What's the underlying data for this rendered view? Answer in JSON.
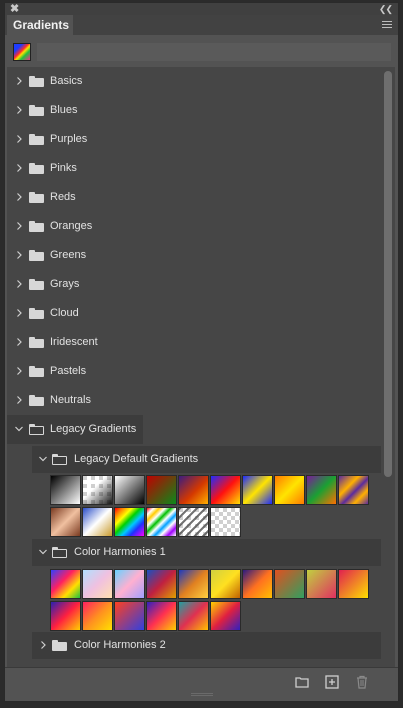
{
  "panel": {
    "tab_label": "Gradients",
    "close_glyph": "✖",
    "collapse_glyph": "❮❮"
  },
  "folders": [
    {
      "label": "Basics"
    },
    {
      "label": "Blues"
    },
    {
      "label": "Purples"
    },
    {
      "label": "Pinks"
    },
    {
      "label": "Reds"
    },
    {
      "label": "Oranges"
    },
    {
      "label": "Greens"
    },
    {
      "label": "Grays"
    },
    {
      "label": "Cloud"
    },
    {
      "label": "Iridescent"
    },
    {
      "label": "Pastels"
    },
    {
      "label": "Neutrals"
    },
    {
      "label": "Legacy Gradients"
    }
  ],
  "subfolders": [
    {
      "label": "Legacy Default Gradients"
    },
    {
      "label": "Color Harmonies 1"
    },
    {
      "label": "Color Harmonies 2"
    }
  ],
  "icons": {
    "expanded": "chevron-down-icon",
    "collapsed": "chevron-right-icon",
    "folder": "folder-icon",
    "new_group": "new-group-icon",
    "new_gradient": "new-gradient-icon",
    "delete": "trash-icon"
  },
  "colors": {
    "panel_bg": "#535353",
    "list_bg": "#464646",
    "selected_row": "#3c3c3c",
    "text": "#e2e2e2"
  },
  "swatches": {
    "legacy_default": [
      "linear-gradient(135deg,#000 0%,#fff 100%)",
      "checker-fade-black",
      "linear-gradient(135deg,#fff 0%,#000 100%)",
      "linear-gradient(135deg,#c00000 0%,#0a8a1a 100%)",
      "linear-gradient(135deg,#3a1c80 0%,#d43800 55%,#ffb000 100%)",
      "linear-gradient(135deg,#1f2cff 0%,#ff1010 50%,#ffe000 100%)",
      "linear-gradient(135deg,#1a2aff 0%,#ffe400 50%,#1a2aff 100%)",
      "linear-gradient(135deg,#ff7a00 0%,#ffe400 50%,#ff7a00 100%)",
      "linear-gradient(135deg,#7a1a9a 0%,#1aa032 50%,#ff7000 100%)",
      "linear-gradient(135deg,#5a2aa0 0%,#ffb000 35%,#5a2aa0 55%,#ffb000 75%,#5a2aa0 100%)",
      "linear-gradient(135deg,#7a3a20 0%,#f0c0a0 50%,#7a3a20 100%)",
      "linear-gradient(135deg,#2b4fc8 0%,#ffffff 50%,#c89a2b 100%)",
      "linear-gradient(135deg,#ff0000 0%,#ff8a00 15%,#ffff00 30%,#00d000 45%,#00c8ff 60%,#2030ff 75%,#ff00ff 100%)",
      "linear-gradient(135deg,#ff0000 0%,#fff 12%,#ffcc00 22%,#fff 32%,#00c000 42%,#fff 52%,#00a0ff 62%,#fff 72%,#a000ff 85%,#fff 100%)",
      "checker-stripes",
      "checker"
    ],
    "harmonies_1": [
      "linear-gradient(135deg,#3040ff 0%,#ff2060 40%,#ffe000 70%,#20c040 100%)",
      "linear-gradient(135deg,#b0e0ff 0%,#f0c0e0 50%,#ffe0b0 100%)",
      "linear-gradient(135deg,#6ad0ff 0%,#ffb0d0 50%,#a0a0ff 100%)",
      "linear-gradient(135deg,#1a50c0 0%,#c02040 50%,#e0a000 100%)",
      "linear-gradient(135deg,#1a3ac0 0%,#e08020 50%,#ffd040 100%)",
      "linear-gradient(135deg,#d0d040 0%,#ffe020 50%,#c06000 100%)",
      "linear-gradient(135deg,#2a1a80 0%,#ff7020 50%,#ffc000 100%)",
      "linear-gradient(135deg,#e05020 0%,#30a060 100%)",
      "linear-gradient(135deg,#c0d040 0%,#e03060 100%)",
      "linear-gradient(135deg,#e02050 0%,#ffe000 100%)",
      "linear-gradient(135deg,#2a20b0 0%,#ff2040 50%,#ffd000 100%)",
      "linear-gradient(135deg,#ff2060 0%,#ff9020 50%,#ffe000 100%)",
      "linear-gradient(135deg,#ff4020 0%,#3040e0 100%)",
      "linear-gradient(135deg,#3020c0 0%,#ff3050 50%,#ffd000 100%)",
      "linear-gradient(135deg,#20a0a0 0%,#e03050 50%,#ffc000 100%)",
      "linear-gradient(135deg,#ffd000 0%,#e02040 50%,#3020c0 100%)"
    ]
  }
}
